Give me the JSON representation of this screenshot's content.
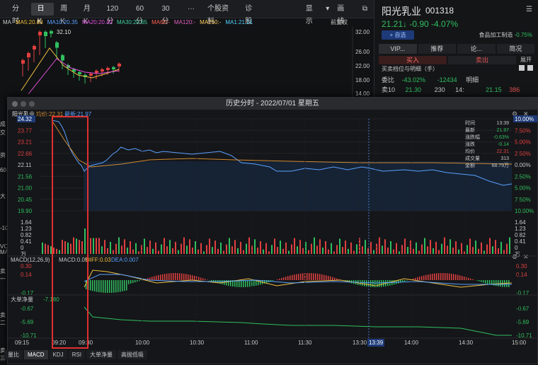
{
  "toolbar": {
    "tabs": [
      "分时",
      "日K",
      "周K",
      "月K",
      "120分",
      "60分",
      "30分"
    ],
    "active_tab": "日K",
    "more": "···",
    "profile": "个股资料",
    "diagnose": "诊股",
    "display": "显示",
    "draw": "画线"
  },
  "ma_line": [
    {
      "text": "MA",
      "color": "#c8c8c8"
    },
    {
      "text": "MA5:20.83",
      "color": "#f0c040"
    },
    {
      "text": "MA10:20.35",
      "color": "#5aa0ff"
    },
    {
      "text": "MA20:20.42",
      "color": "#e050e0"
    },
    {
      "text": "MA30:20.65",
      "color": "#40d0a0"
    },
    {
      "text": "MA60:-",
      "color": "#ff6050"
    },
    {
      "text": "MA120:-",
      "color": "#e060c0"
    },
    {
      "text": "MA250:-",
      "color": "#ffd060"
    },
    {
      "text": "MA1:21.21",
      "color": "#50d0ff"
    }
  ],
  "restore_label": "前复权",
  "kchart": {
    "yticks": [
      "32.00",
      "26.00",
      "22.00",
      "18.00",
      "14.00"
    ],
    "max_label": "32.10"
  },
  "quote": {
    "name": "阳光乳业",
    "code": "001318",
    "price_line": "21.21↓ -0.90 -4.07%",
    "add_button": "+ 自选",
    "industry": "食品加工制造",
    "industry_change": "-0.75%",
    "tabs": [
      "VIP...",
      "推荐",
      "论...",
      "简况"
    ],
    "buy": "买入",
    "sell": "卖出",
    "expand": "展开",
    "depth_title": "买卖档位与明细（手）",
    "ratio_label": "委比",
    "ratio_value": "-43.02%",
    "ratio_diff": "-12434",
    "detail_label": "明细",
    "sell10_label": "卖10",
    "sell10_price": "21.30",
    "sell10_vol": "230",
    "detail_time": "14:",
    "detail_price": "21.15",
    "detail_vol": "386"
  },
  "dialog": {
    "title": "历史分时 - 2022/07/01 星期五",
    "stock_name": "阳光乳业",
    "avg_label": "均价:22.31",
    "last_label": "最新:21.97",
    "left_ticks": [
      "24.32",
      "23.77",
      "23.21",
      "22.66",
      "22.11",
      "21.56",
      "21.00",
      "20.45",
      "19.90"
    ],
    "right_ticks": [
      "10.00%",
      "7.50%",
      "5.00%",
      "2.50%",
      "0.00%",
      "2.50%",
      "5.00%",
      "7.50%",
      "10.00%"
    ],
    "vol_ticks": [
      "1.64",
      "1.23",
      "0.82",
      "0.41",
      "0",
      "万"
    ],
    "macd_label": "MACD(12,26,9)",
    "macd_val": "MACD:0.05",
    "diff_val": "DIFF:0.03",
    "dea_val": "DEA:0.007",
    "macd_ticks": [
      "0.30",
      "0.14",
      "-0.17"
    ],
    "net_label": "大单净量",
    "net_val": "-7.180",
    "net_ticks": [
      "-0.67",
      "-5.69",
      "-10.71"
    ],
    "time_ticks": [
      "09:15",
      "09:20",
      "09:30",
      "10:00",
      "10:30",
      "11:00",
      "11:30",
      "13:30",
      "13:39",
      "14:00",
      "14:30",
      "15:00"
    ],
    "cursor_time": "13:39",
    "info": [
      {
        "k": "时间",
        "v": "13:39",
        "c": "#c8c8c8"
      },
      {
        "k": "最新",
        "v": "21.97",
        "c": "#2fbf5f"
      },
      {
        "k": "涨跌幅",
        "v": "-0.63%",
        "c": "#2fbf5f"
      },
      {
        "k": "涨跌",
        "v": "-0.14",
        "c": "#2fbf5f"
      },
      {
        "k": "均价",
        "v": "22.31",
        "c": "#e04040"
      },
      {
        "k": "成交量",
        "v": "313",
        "c": "#c8c8c8"
      },
      {
        "k": "金额",
        "v": "68.79万",
        "c": "#c8c8c8"
      }
    ],
    "bottom_tabs": [
      "量比",
      "MACD",
      "KDJ",
      "RSI",
      "大单净量",
      "高抛低吸"
    ],
    "bottom_active": "MACD"
  },
  "side_labels": [
    "成",
    "交",
    "资",
    "60",
    "大",
    "-10",
    "VO",
    "MA",
    "卖一",
    "卖二",
    "卖三"
  ],
  "colors": {
    "up": "#e04040",
    "down": "#2fbf5f",
    "price_line": "#5aa0ff",
    "avg_line": "#d08a30",
    "highlight": "#e03030"
  }
}
